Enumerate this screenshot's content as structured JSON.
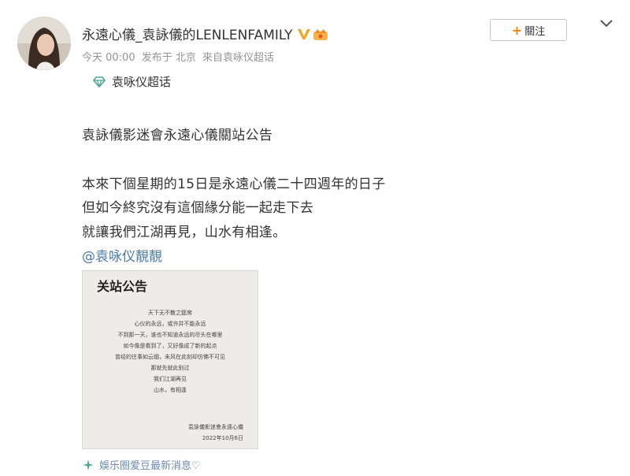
{
  "user": {
    "name": "永遠心儀_袁詠儀的LENLENFAMILY",
    "verified_icon": "verified-v-icon",
    "member_icon": "crown-icon"
  },
  "meta": {
    "time": "今天 00:00",
    "location": "发布于 北京",
    "via": "來自袁咏仪超话"
  },
  "topic": {
    "icon": "diamond-icon",
    "label": "袁咏仪超话"
  },
  "follow_button": {
    "plus": "+",
    "label": "關注"
  },
  "post": {
    "lines": [
      "袁詠儀影迷會永遠心儀關站公告",
      "本來下個星期的15日是永遠心儀二十四週年的日子",
      "但如今終究沒有這個緣分能一起走下去",
      "就讓我們江湖再見，山水有相逢。"
    ],
    "mention": "@袁咏仪靚靚"
  },
  "notice_image": {
    "title": "关站公告",
    "lines": [
      "天下无不散之筵席",
      "心仪的永远，或许并不能永远",
      "不到那一天，谁也不知道永远的尽头在哪里",
      "如今像是看到了，又好像成了新的起点",
      "曾经的往事如云烟，未风在此刻却仿佛不可见",
      "那就先就此别过",
      "我们江湖再见",
      "山水，有相逢"
    ],
    "signature": "袁詠儀影迷會永遠心儀",
    "date": "2022年10月6日"
  },
  "source": {
    "icon": "sparkle-icon",
    "label": "娛乐圈爱豆最新消息♡"
  },
  "colors": {
    "accent_orange": "#ff8200",
    "link_blue": "#4a7aa8",
    "meta_gray": "#939393"
  }
}
